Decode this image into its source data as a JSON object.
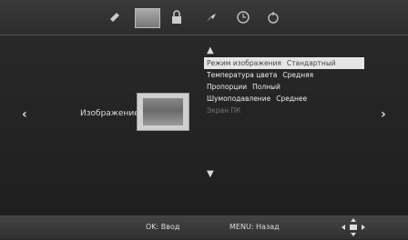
{
  "top_icons": [
    "sound-icon",
    "picture-icon",
    "lock-icon",
    "setup-icon",
    "time-icon",
    "option-icon"
  ],
  "page": {
    "title": "Изображение"
  },
  "menu": [
    {
      "label": "Режим изображения",
      "value": "Стандартный",
      "selected": true
    },
    {
      "label": "Температура цвета",
      "value": "Средняя"
    },
    {
      "label": "Пропорции",
      "value": "Полный"
    },
    {
      "label": "Шумоподавление",
      "value": "Среднее"
    },
    {
      "label": "Экран ПК",
      "value": "",
      "disabled": true
    }
  ],
  "hints": {
    "ok": "OK: Ввод",
    "menu": "MENU: Назад"
  },
  "colors": {
    "background": "#262626",
    "selection": "#e6e6e6"
  }
}
